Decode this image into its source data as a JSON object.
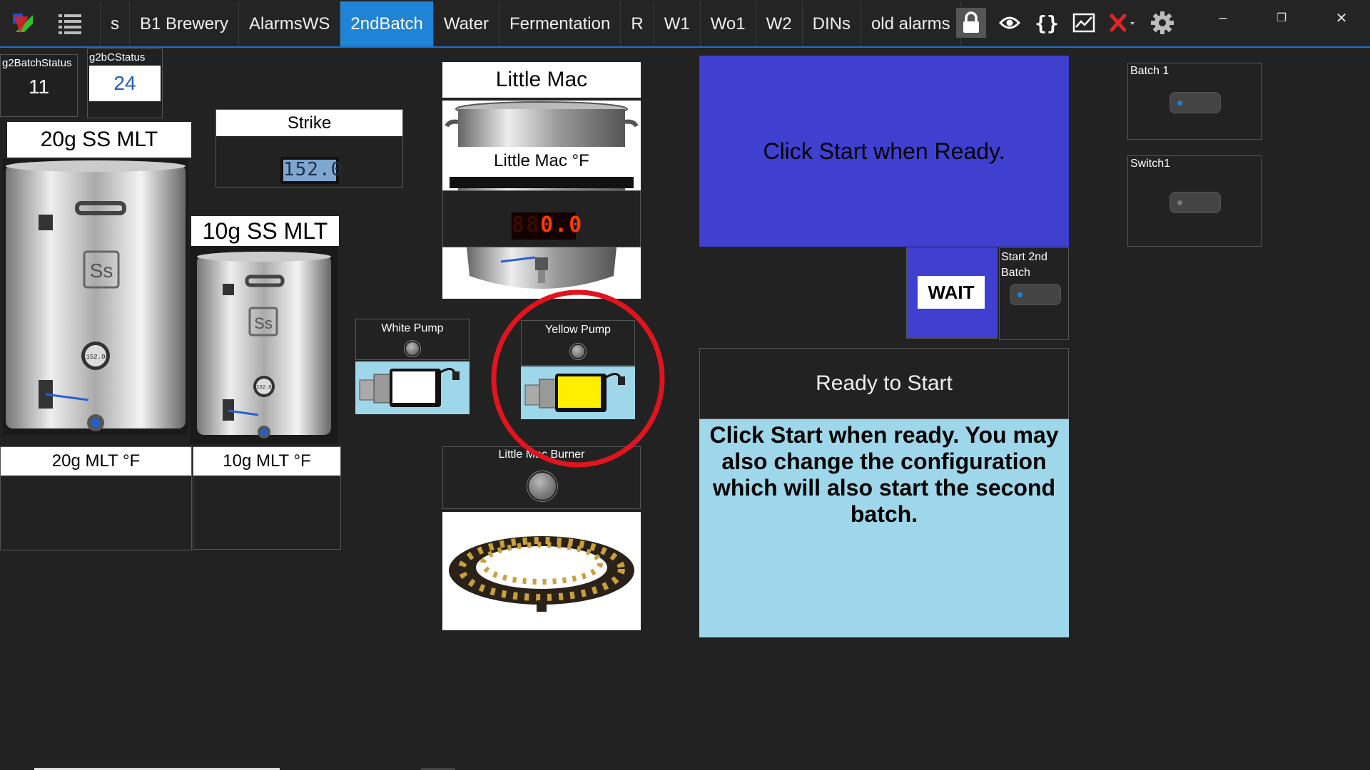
{
  "app": {
    "tabs": [
      {
        "label": "s",
        "active": false
      },
      {
        "label": "B1 Brewery",
        "active": false
      },
      {
        "label": "AlarmsWS",
        "active": false
      },
      {
        "label": "2ndBatch",
        "active": true
      },
      {
        "label": "Water",
        "active": false
      },
      {
        "label": "Fermentation",
        "active": false
      },
      {
        "label": "R",
        "active": false
      },
      {
        "label": "W1",
        "active": false
      },
      {
        "label": "Wo1",
        "active": false
      },
      {
        "label": "W2",
        "active": false
      },
      {
        "label": "DINs",
        "active": false
      },
      {
        "label": "old alarms",
        "active": false
      }
    ],
    "accent_color": "#1f83d6",
    "window_controls": {
      "minimize": "–",
      "maximize": "❐",
      "close": "✕"
    }
  },
  "status": {
    "g2batch_label": "g2BatchStatus",
    "g2batch_value": "11",
    "g2bc_label": "g2bCStatus",
    "g2bc_value": "24"
  },
  "mlt20": {
    "title": "20g SS MLT",
    "temp_label": "20g MLT  °F",
    "badge": "Ss",
    "gauge": "152.0"
  },
  "mlt10": {
    "title": "10g SS MLT",
    "temp_label": "10g MLT  °F",
    "badge": "Ss",
    "gauge": "152.0"
  },
  "strike": {
    "label": "Strike",
    "value": "152.0"
  },
  "little_mac": {
    "title": "Little Mac",
    "temp_label": "Little Mac °F",
    "ghost": "88",
    "value": "0.0"
  },
  "pumps": {
    "white": {
      "label": "White Pump",
      "color": "#ffffff"
    },
    "yellow": {
      "label": "Yellow Pump",
      "color": "#ffee00"
    }
  },
  "burner": {
    "label": "Little Mac Burner"
  },
  "controls": {
    "ready_message": "Click Start when Ready.",
    "wait_label": "WAIT",
    "start2nd_label": "Start 2nd Batch",
    "ready_to_start": "Ready to Start",
    "description": "Click Start when ready.  You may also change the configuration which will also start the second batch.",
    "ready_color": "#3f3fd0",
    "desc_color": "#9fd7ea"
  },
  "switches": {
    "batch1_label": "Batch 1",
    "switch1_label": "Switch1"
  },
  "annotation": {
    "color": "#e0141e"
  }
}
